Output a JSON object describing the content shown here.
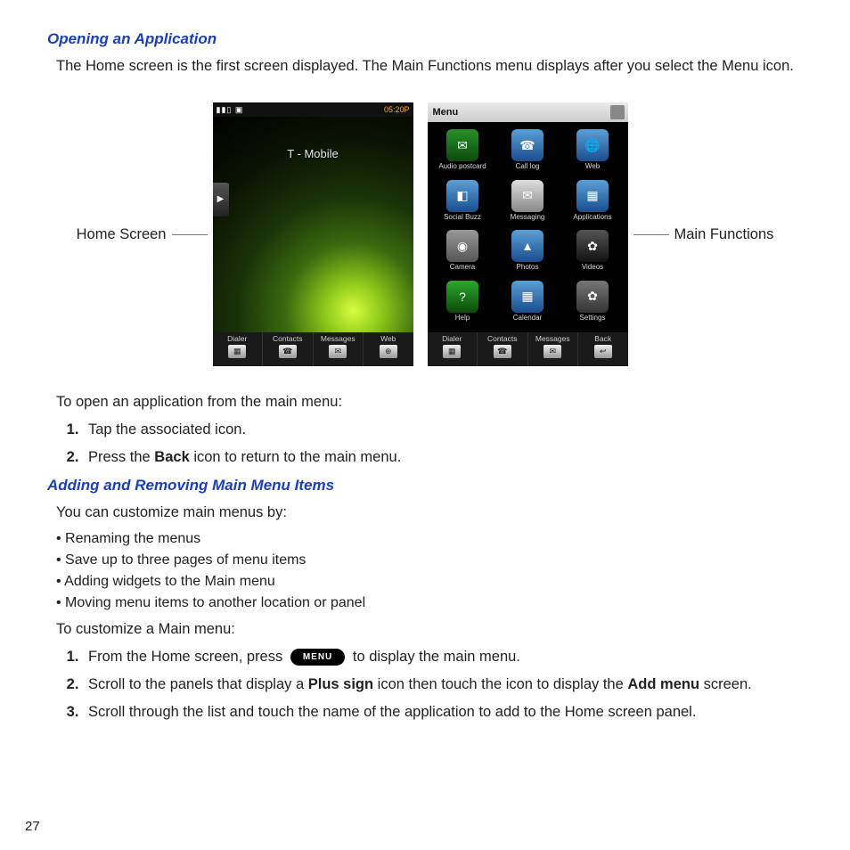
{
  "section1": {
    "heading": "Opening an Application",
    "intro": "The Home screen is the first screen displayed. The Main Functions menu displays after you select the Menu icon.",
    "leftCaption": "Home Screen",
    "rightCaption": "Main Functions",
    "homeScreen": {
      "time": "05:20P",
      "carrier": "T - Mobile",
      "softkeys": [
        "Dialer",
        "Contacts",
        "Messages",
        "Web"
      ]
    },
    "menuScreen": {
      "title": "Menu",
      "apps": [
        {
          "label": "Audio postcard",
          "glyph": "✉"
        },
        {
          "label": "Call log",
          "glyph": "☎"
        },
        {
          "label": "Web",
          "glyph": "🌐"
        },
        {
          "label": "Social Buzz",
          "glyph": "◧"
        },
        {
          "label": "Messaging",
          "glyph": "✉"
        },
        {
          "label": "Applications",
          "glyph": "▦"
        },
        {
          "label": "Camera",
          "glyph": "◉"
        },
        {
          "label": "Photos",
          "glyph": "▲"
        },
        {
          "label": "Videos",
          "glyph": "✿"
        },
        {
          "label": "Help",
          "glyph": "?"
        },
        {
          "label": "Calendar",
          "glyph": "▦"
        },
        {
          "label": "Settings",
          "glyph": "✿"
        }
      ],
      "softkeys": [
        "Dialer",
        "Contacts",
        "Messages",
        "Back"
      ]
    },
    "openIntro": "To open an application from the main menu:",
    "step1": "Tap the associated icon.",
    "step2_pre": "Press the ",
    "step2_bold": "Back",
    "step2_post": " icon to return to the main menu."
  },
  "section2": {
    "heading": "Adding and Removing Main Menu Items",
    "intro": "You can customize main menus by:",
    "bullets": [
      "Renaming the menus",
      "Save up to three pages of menu items",
      "Adding widgets to the Main menu",
      "Moving menu items to another location or panel"
    ],
    "custIntro": "To customize a Main menu:",
    "step1_pre": "From the Home screen, press ",
    "step1_pill": "MENU",
    "step1_post": " to display the main menu.",
    "step2_pre": "Scroll to the panels that display a ",
    "step2_bold1": "Plus sign",
    "step2_mid": " icon then touch the icon to display the ",
    "step2_bold2": "Add menu",
    "step2_post": " screen.",
    "step3": "Scroll through the list and touch the name of the application to add to the Home screen panel."
  },
  "pageNumber": "27"
}
